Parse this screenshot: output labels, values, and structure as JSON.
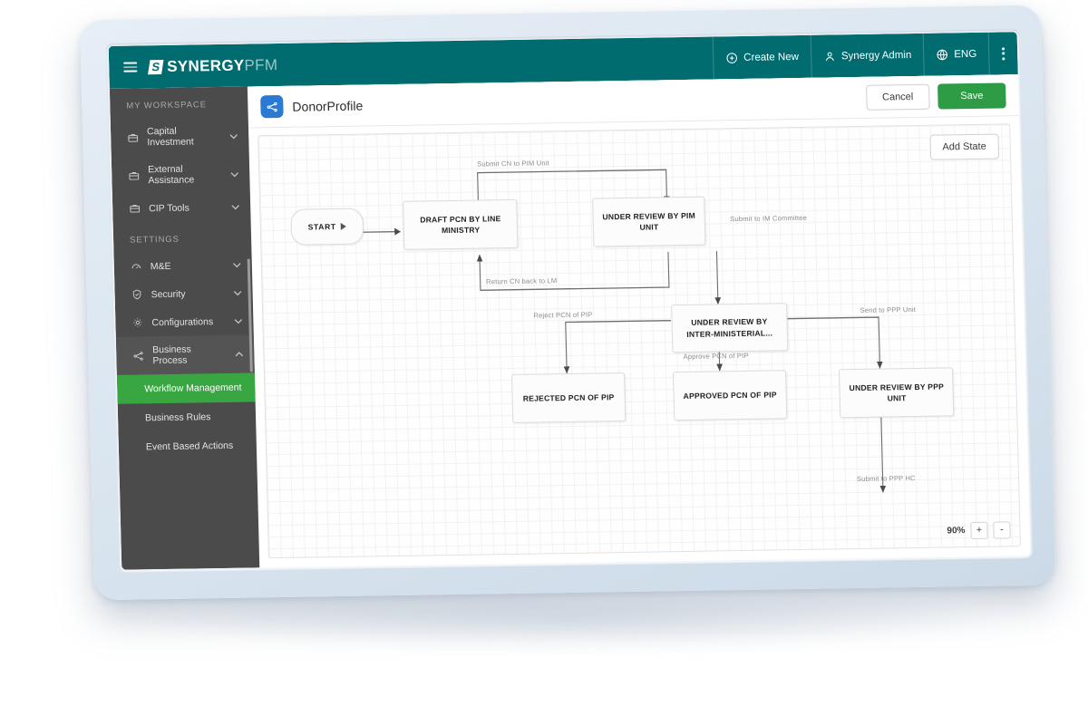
{
  "topbar": {
    "menu_icon": "hamburger-icon",
    "logo_mark": "S",
    "logo_primary": "SYNERGY",
    "logo_secondary": "PFM",
    "items": [
      {
        "label": "Create New",
        "icon": "plus-circle-icon"
      },
      {
        "label": "Synergy Admin",
        "icon": "user-icon"
      },
      {
        "label": "ENG",
        "icon": "globe-icon"
      }
    ],
    "overflow_icon": "vertical-dots-icon",
    "bg_color": "#016c6f"
  },
  "sidebar": {
    "sections": [
      {
        "caption": "MY WORKSPACE",
        "items": [
          {
            "label": "Capital Investment",
            "icon": "briefcase-icon",
            "chevron": "chevron-down-icon",
            "expanded": false
          },
          {
            "label": "External Assistance",
            "icon": "briefcase-icon",
            "chevron": "chevron-down-icon",
            "expanded": false
          },
          {
            "label": "CIP Tools",
            "icon": "briefcase-icon",
            "chevron": "chevron-down-icon",
            "expanded": false
          }
        ]
      },
      {
        "caption": "SETTINGS",
        "items": [
          {
            "label": "M&E",
            "icon": "gauge-icon",
            "chevron": "chevron-down-icon",
            "expanded": false
          },
          {
            "label": "Security",
            "icon": "shield-check-icon",
            "chevron": "chevron-down-icon",
            "expanded": false
          },
          {
            "label": "Configurations",
            "icon": "gear-icon",
            "chevron": "chevron-down-icon",
            "expanded": false
          },
          {
            "label": "Business Process",
            "icon": "workflow-icon",
            "chevron": "chevron-up-icon",
            "expanded": true
          }
        ]
      }
    ],
    "sub_items": [
      {
        "label": "Workflow Management",
        "active": true
      },
      {
        "label": "Business Rules",
        "active": false
      },
      {
        "label": "Event Based Actions",
        "active": false
      }
    ],
    "active_color": "#38a741",
    "bg_color": "#4b4b4b"
  },
  "page": {
    "badge_icon": "workflow-icon",
    "badge_color": "#2a7ad3",
    "title": "DonorProfile",
    "cancel_label": "Cancel",
    "save_label": "Save",
    "save_color": "#2e9b45"
  },
  "canvas": {
    "add_state_label": "Add State",
    "zoom_value": "90%",
    "zoom_in_label": "+",
    "zoom_out_label": "-"
  },
  "chart_data": {
    "type": "diagram",
    "title": "DonorProfile workflow",
    "nodes": [
      {
        "id": "start",
        "label": "START",
        "shape": "pill"
      },
      {
        "id": "draft",
        "label": "DRAFT PCN BY LINE MINISTRY",
        "shape": "box"
      },
      {
        "id": "pim",
        "label": "UNDER REVIEW BY PIM UNIT",
        "shape": "box"
      },
      {
        "id": "interm",
        "label": "UNDER REVIEW BY INTER-MINISTERIAL...",
        "shape": "box"
      },
      {
        "id": "rejected",
        "label": "REJECTED PCN OF PIP",
        "shape": "box"
      },
      {
        "id": "approved",
        "label": "APPROVED PCN OF PIP",
        "shape": "box"
      },
      {
        "id": "ppp",
        "label": "UNDER REVIEW BY PPP UNIT",
        "shape": "box"
      }
    ],
    "edges": [
      {
        "from": "start",
        "to": "draft",
        "label": ""
      },
      {
        "from": "draft",
        "to": "pim",
        "label": "Submit CN to PIM Unit"
      },
      {
        "from": "pim",
        "to": "draft",
        "label": "Return CN back to LM"
      },
      {
        "from": "pim",
        "to": "interm",
        "label": "Submit to IM Committee"
      },
      {
        "from": "interm",
        "to": "rejected",
        "label": "Reject PCN of PIP"
      },
      {
        "from": "interm",
        "to": "approved",
        "label": "Approve PCN of PIP"
      },
      {
        "from": "interm",
        "to": "ppp",
        "label": "Send to PPP Unit"
      },
      {
        "from": "ppp",
        "to": "",
        "label": "Submit to PPP HC"
      }
    ]
  }
}
